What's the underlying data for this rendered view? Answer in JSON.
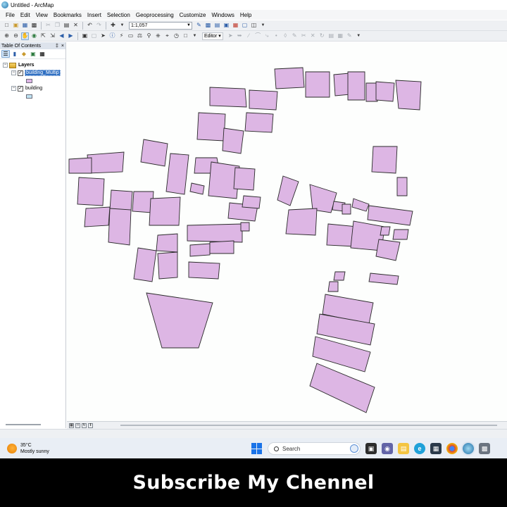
{
  "window": {
    "title": "Untitled - ArcMap"
  },
  "menu": [
    "File",
    "Edit",
    "View",
    "Bookmarks",
    "Insert",
    "Selection",
    "Geoprocessing",
    "Customize",
    "Windows",
    "Help"
  ],
  "toolbar": {
    "scale_value": "1:1,057",
    "editor_label": "Editor ▾"
  },
  "toc": {
    "title": "Table Of Contents",
    "pin": "‡",
    "close": "×",
    "root": "Layers",
    "layers": [
      {
        "name": "building_Multip",
        "checked": "✓",
        "expander": "−",
        "selected": true,
        "swatch_color": "#ddb6e4"
      },
      {
        "name": "building",
        "checked": "✓",
        "expander": "−",
        "selected": false,
        "swatch_color": "#bfe3f2"
      }
    ]
  },
  "map": {
    "building_fill": "#ddb6e4",
    "background": "#fdfefd"
  },
  "taskbar": {
    "weather_temp": "35°C",
    "weather_desc": "Mostly sunny",
    "search_placeholder": "Search",
    "apps": [
      "copilot",
      "teams-chat",
      "file-explorer",
      "edge",
      "store",
      "chrome",
      "arcmap",
      "extra"
    ]
  },
  "caption": "Subscribe My Chennel",
  "icons": {
    "new": "new-doc-icon",
    "open": "open-folder-icon",
    "save": "save-icon",
    "print": "print-icon",
    "zoom_in": "zoom-in-icon",
    "zoom_out": "zoom-out-icon",
    "pan": "pan-icon",
    "identify": "identify-icon"
  }
}
